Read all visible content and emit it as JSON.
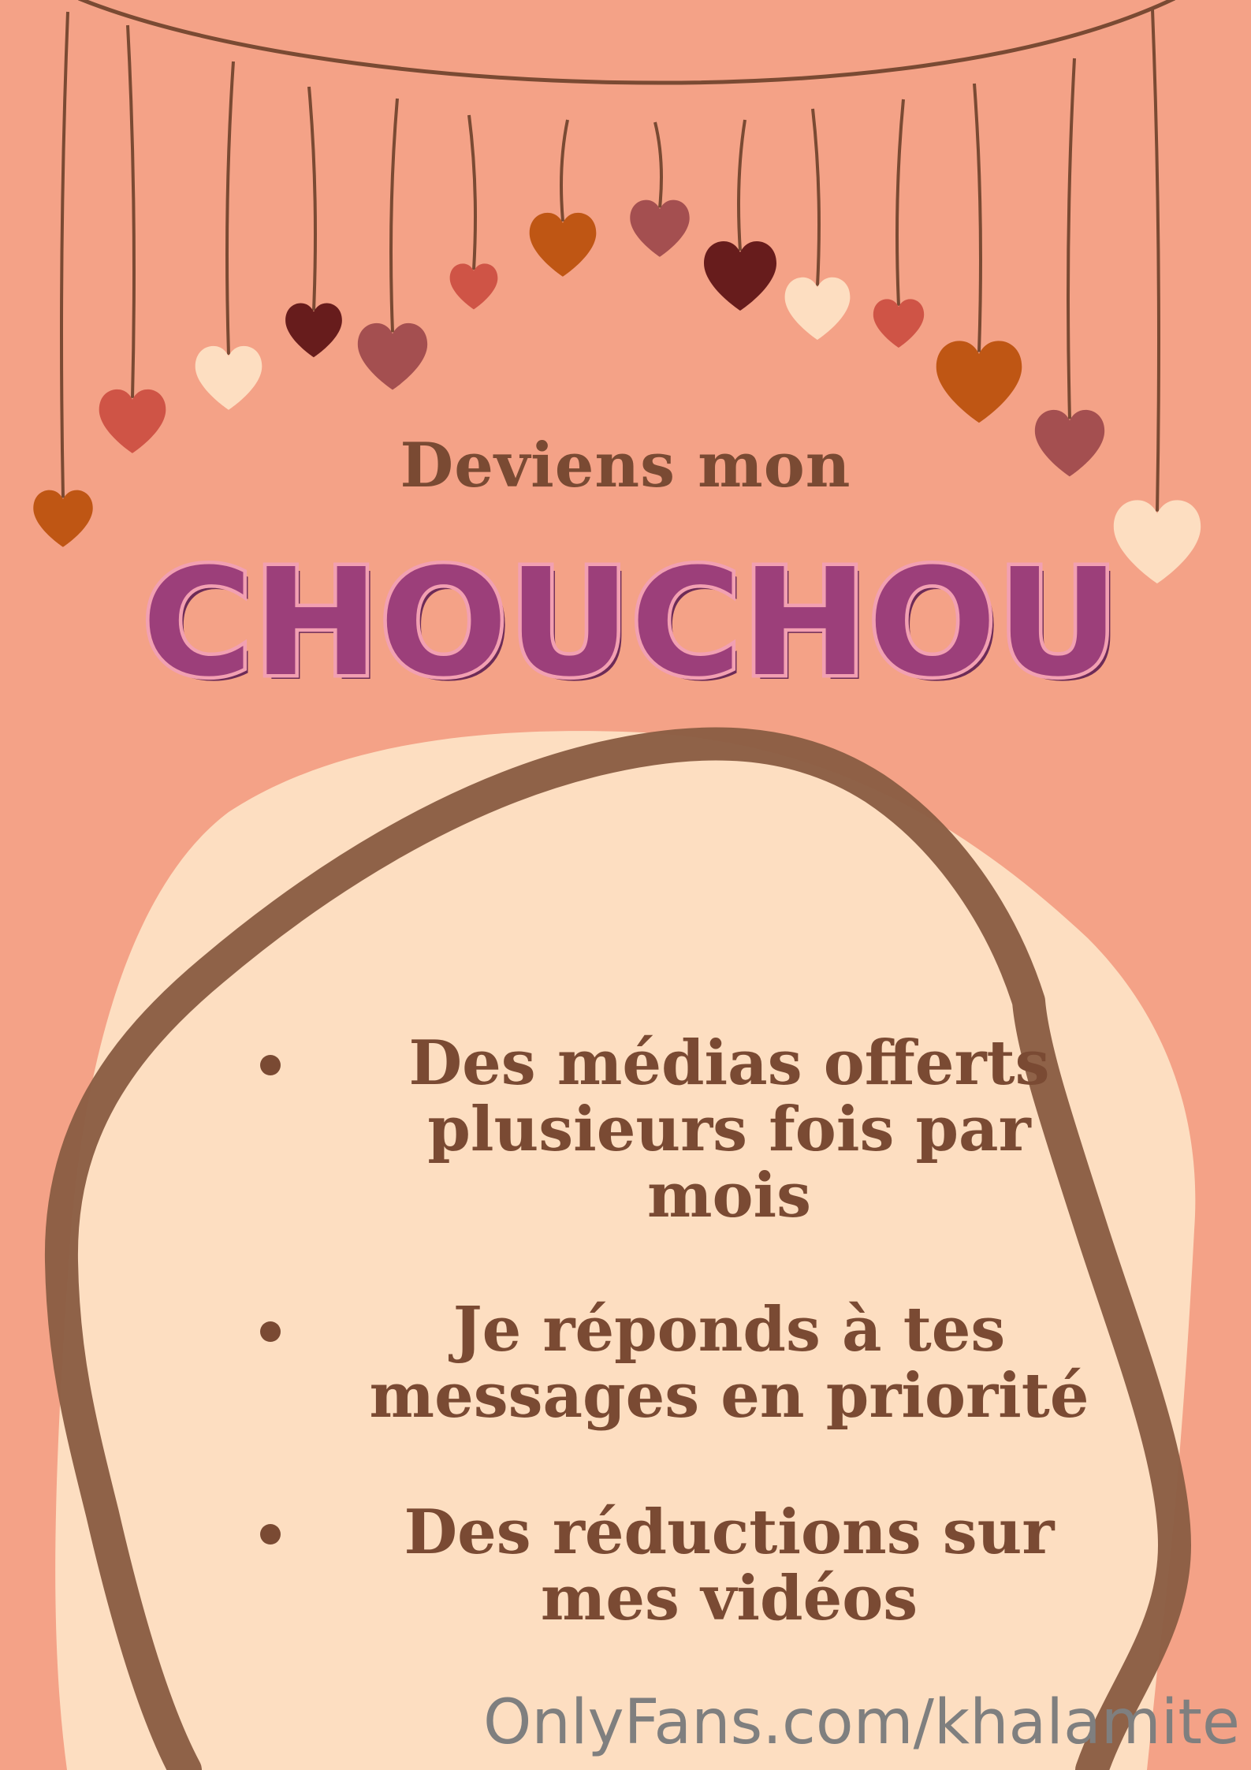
{
  "colors": {
    "background": "#f4a287",
    "blob": "#fddec1",
    "ring": "#8b5e44",
    "string": "#7a4a33",
    "text": "#7a4a33",
    "headline_fill": "#9c3f7a",
    "headline_outline": "#f2a0b2",
    "footer": "#7f7f7f"
  },
  "hearts": [
    {
      "icon": "heart-icon",
      "color": "#bf5614"
    },
    {
      "icon": "heart-icon",
      "color": "#cf5446"
    },
    {
      "icon": "heart-icon",
      "color": "#fddec1"
    },
    {
      "icon": "heart-icon",
      "color": "#671c1c"
    },
    {
      "icon": "heart-icon",
      "color": "#a44f50"
    },
    {
      "icon": "heart-icon",
      "color": "#cf5446"
    },
    {
      "icon": "heart-icon",
      "color": "#bf5614"
    },
    {
      "icon": "heart-icon",
      "color": "#a44f50"
    },
    {
      "icon": "heart-icon",
      "color": "#671c1c"
    },
    {
      "icon": "heart-icon",
      "color": "#fddec1"
    },
    {
      "icon": "heart-icon",
      "color": "#cf5446"
    },
    {
      "icon": "heart-icon",
      "color": "#bf5614"
    },
    {
      "icon": "heart-icon",
      "color": "#a44f50"
    },
    {
      "icon": "heart-icon",
      "color": "#fddec1"
    }
  ],
  "intro": "Deviens mon",
  "headline": "CHOUCHOU",
  "bullets": [
    {
      "lines": [
        "Des médias offerts",
        "plusieurs fois par",
        "mois"
      ]
    },
    {
      "lines": [
        "Je réponds à tes",
        "messages en priorité"
      ]
    },
    {
      "lines": [
        "Des réductions sur",
        "mes vidéos"
      ]
    }
  ],
  "footer": "OnlyFans.com/khalamite"
}
